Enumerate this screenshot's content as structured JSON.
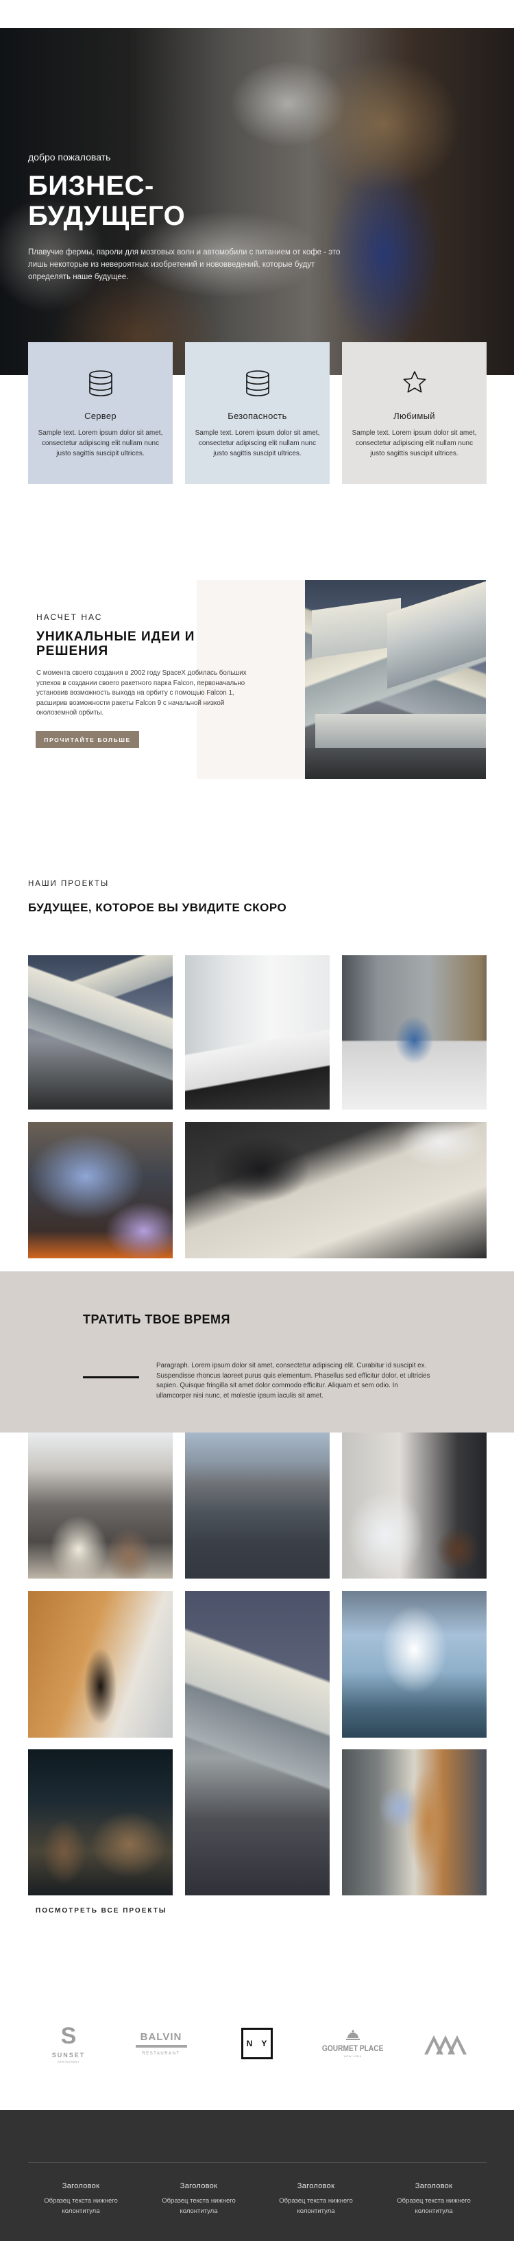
{
  "hero": {
    "kicker": "добро пожаловать",
    "title": "БИЗНЕС-БУДУЩЕГО",
    "text": "Плавучие фермы, пароли для мозговых волн и автомобили с питанием от кофе - это лишь некоторые из невероятных изобретений и нововведений, которые будут определять наше будущее."
  },
  "features": [
    {
      "icon": "database-icon",
      "title": "Сервер",
      "text": "Sample text. Lorem ipsum dolor sit amet, consectetur adipiscing elit nullam nunc justo sagittis suscipit ultrices.",
      "bg": "#cdd5e3"
    },
    {
      "icon": "database-icon",
      "title": "Безопасность",
      "text": "Sample text. Lorem ipsum dolor sit amet, consectetur adipiscing elit nullam nunc justo sagittis suscipit ultrices.",
      "bg": "#d8e0e8"
    },
    {
      "icon": "star-icon",
      "title": "Любимый",
      "text": "Sample text. Lorem ipsum dolor sit amet, consectetur adipiscing elit nullam nunc justo sagittis suscipit ultrices.",
      "bg": "#e3e2e0"
    }
  ],
  "about": {
    "kicker": "НАСЧЕТ НАС",
    "title": "УНИКАЛЬНЫЕ ИДЕИ И РЕШЕНИЯ",
    "text": "С момента своего создания в 2002 году SpaceX добилась больших успехов в создании своего ракетного парка Falcon, первоначально установив возможность выхода на орбиту с помощью Falcon 1, расширив возможности ракеты Falcon 9 с начальной низкой околоземной орбиты.",
    "button_label": "ПРОЧИТАЙТЕ БОЛЬШЕ",
    "button_color": "#8d7d6d",
    "image": "modern-building-photo"
  },
  "projects": {
    "kicker": "НАШИ ПРОЕКТЫ",
    "title": "БУДУЩЕЕ, КОТОРОЕ ВЫ УВИДИТЕ СКОРО",
    "gallery": [
      "modern-building-photo",
      "conference-room-photo",
      "man-with-laptop-whiteboard-photo",
      "man-in-blue-shirt-laptop-photo",
      "laptops-on-desk-photo"
    ]
  },
  "spend_time": {
    "title": "ТРАТИТЬ ТВОЕ ВРЕМЯ",
    "text": "Paragraph. Lorem ipsum dolor sit amet, consectetur adipiscing elit. Curabitur id suscipit ex. Suspendisse rhoncus laoreet purus quis elementum. Phasellus sed efficitur dolor, et ultricies sapien. Quisque fringilla sit amet dolor commodo efficitur. Aliquam et sem odio. In ullamcorper nisi nunc, et molestie ipsum iaculis sit amet.",
    "bg": "#d5d0cc"
  },
  "gallery2": {
    "images": [
      "conference-audience-photo",
      "city-aerial-photo",
      "business-newspaper-photo",
      "man-on-staircase-photo",
      "modern-building-tall-photo",
      "skyscrapers-sky-photo",
      "night-building-photo",
      "team-meeting-blueprints-photo"
    ],
    "view_all_label": "ПОСМОТРЕТЬ ВСЕ ПРОЕКТЫ"
  },
  "logos": {
    "sunset": {
      "letter": "S",
      "name": "SUNSET",
      "sub": "RESTAURANT"
    },
    "balvin": {
      "name": "BALVIN",
      "sub": "RESTAURANT"
    },
    "ny": {
      "name": "N Y"
    },
    "gourmet": {
      "name": "GOURMET PLACE",
      "sub": "NEW YORK"
    },
    "mountain": {
      "icon": "mountain-logo-icon"
    }
  },
  "footer": {
    "columns": [
      {
        "heading": "Заголовок",
        "text": "Образец текста нижнего колонтитула"
      },
      {
        "heading": "Заголовок",
        "text": "Образец текста нижнего колонтитула"
      },
      {
        "heading": "Заголовок",
        "text": "Образец текста нижнего колонтитула"
      },
      {
        "heading": "Заголовок",
        "text": "Образец текста нижнего колонтитула"
      }
    ],
    "bg": "#333333"
  }
}
